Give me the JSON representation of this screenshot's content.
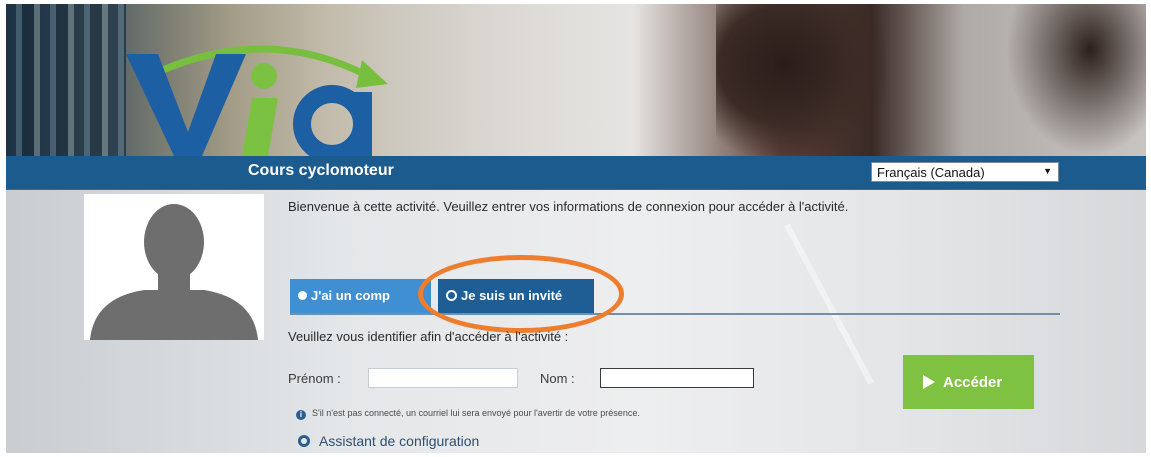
{
  "course": {
    "title": "Cours cyclomoteur"
  },
  "language": {
    "selected": "Français (Canada)"
  },
  "welcome_text": "Bienvenue à cette activité. Veuillez entrer vos informations de connexion pour accéder à l'activité.",
  "tabs": [
    {
      "label": "J'ai un comp"
    },
    {
      "label": "Je suis un invité"
    }
  ],
  "form": {
    "identify_text": "Veuillez vous identifier afin d'accéder à l'activité :",
    "first_name_label": "Prénom :",
    "last_name_label": "Nom :",
    "first_name_value": "",
    "last_name_value": ""
  },
  "access_button": {
    "label": "Accéder"
  },
  "note": {
    "text": "S'il n'est pas connecté, un courriel lui sera envoyé pour l'avertir de votre présence."
  },
  "wizard": {
    "label": "Assistant de configuration"
  },
  "colors": {
    "band": "#1c5b8e",
    "tab_account": "#3f8fd2",
    "tab_guest": "#1f5e95",
    "access_button": "#7fc241",
    "highlight": "#ee7d2e"
  }
}
